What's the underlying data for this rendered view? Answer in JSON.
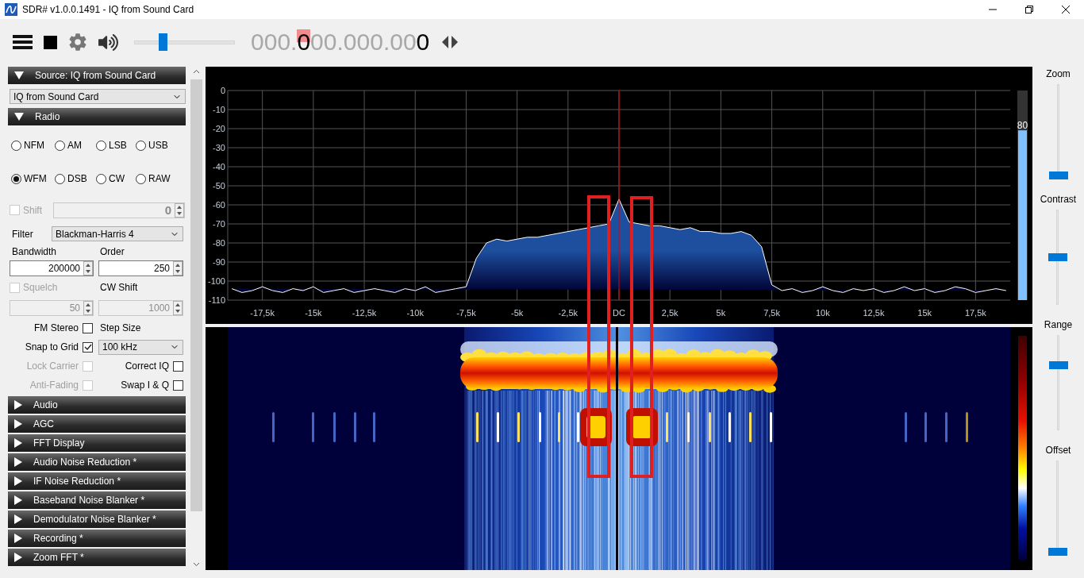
{
  "window": {
    "title": "SDR# v1.0.0.1491 - IQ from Sound Card"
  },
  "toolbar": {
    "volume": {
      "level": 0.27
    },
    "frequency": [
      {
        "kind": "digit",
        "text": "0",
        "lit": false,
        "hover": false
      },
      {
        "kind": "digit",
        "text": "0",
        "lit": false,
        "hover": false
      },
      {
        "kind": "digit",
        "text": "0",
        "lit": false,
        "hover": false
      },
      {
        "kind": "separator",
        "text": "."
      },
      {
        "kind": "digit",
        "text": "0",
        "lit": true,
        "hover": true
      },
      {
        "kind": "digit",
        "text": "0",
        "lit": false,
        "hover": false
      },
      {
        "kind": "digit",
        "text": "0",
        "lit": false,
        "hover": false
      },
      {
        "kind": "separator",
        "text": "."
      },
      {
        "kind": "digit",
        "text": "0",
        "lit": false,
        "hover": false
      },
      {
        "kind": "digit",
        "text": "0",
        "lit": false,
        "hover": false
      },
      {
        "kind": "digit",
        "text": "0",
        "lit": false,
        "hover": false
      },
      {
        "kind": "separator",
        "text": "."
      },
      {
        "kind": "digit",
        "text": "0",
        "lit": false,
        "hover": false
      },
      {
        "kind": "digit",
        "text": "0",
        "lit": false,
        "hover": false
      },
      {
        "kind": "digit",
        "text": "0",
        "lit": true,
        "hover": false
      }
    ]
  },
  "sidebar": {
    "source": {
      "title": "Source: IQ from Sound Card",
      "expanded": true,
      "device": "IQ from Sound Card"
    },
    "radio": {
      "title": "Radio",
      "expanded": true,
      "modes": [
        {
          "label": "NFM",
          "selected": false
        },
        {
          "label": "AM",
          "selected": false
        },
        {
          "label": "LSB",
          "selected": false
        },
        {
          "label": "USB",
          "selected": false
        },
        {
          "label": "WFM",
          "selected": true
        },
        {
          "label": "DSB",
          "selected": false
        },
        {
          "label": "CW",
          "selected": false
        },
        {
          "label": "RAW",
          "selected": false
        }
      ],
      "shift": {
        "label": "Shift",
        "checked": false,
        "disabled": true,
        "value": "0"
      },
      "filter": {
        "label": "Filter",
        "value": "Blackman-Harris 4"
      },
      "bandwidth": {
        "label": "Bandwidth",
        "value": "200000"
      },
      "order": {
        "label": "Order",
        "value": "250"
      },
      "squelch": {
        "label": "Squelch",
        "checked": false,
        "disabled": true,
        "value": "50"
      },
      "cw_shift": {
        "label": "CW Shift",
        "disabled": true,
        "value": "1000"
      },
      "left_checks": [
        {
          "label": "FM Stereo",
          "checked": false,
          "disabled": false
        },
        {
          "label": "Snap to Grid",
          "checked": true,
          "disabled": false
        },
        {
          "label": "Lock Carrier",
          "checked": false,
          "disabled": true
        },
        {
          "label": "Anti-Fading",
          "checked": false,
          "disabled": true
        }
      ],
      "step_size": {
        "label": "Step Size",
        "value": "100 kHz"
      },
      "right_checks": [
        {
          "label": "Correct IQ",
          "checked": false
        },
        {
          "label": "Swap I & Q",
          "checked": false
        }
      ]
    },
    "sections": [
      {
        "title": "Audio",
        "expanded": false
      },
      {
        "title": "AGC",
        "expanded": false
      },
      {
        "title": "FFT Display",
        "expanded": false
      },
      {
        "title": "Audio Noise Reduction *",
        "expanded": false
      },
      {
        "title": "IF Noise Reduction *",
        "expanded": false
      },
      {
        "title": "Baseband Noise Blanker *",
        "expanded": false
      },
      {
        "title": "Demodulator Noise Blanker *",
        "expanded": false
      },
      {
        "title": "Recording *",
        "expanded": false
      },
      {
        "title": "Zoom FFT *",
        "expanded": false
      }
    ]
  },
  "spectrum": {
    "chart_data": {
      "type": "area",
      "grid": true,
      "ref_lines": [
        {
          "axis": "x",
          "value": 0,
          "color": "#e00000"
        }
      ],
      "xlim": [
        -19.2,
        19.2
      ],
      "ylim": [
        -110,
        0
      ],
      "x": [
        -19,
        -18.5,
        -18,
        -17.5,
        -17,
        -16.5,
        -16,
        -15.5,
        -15,
        -14.5,
        -14,
        -13.5,
        -13,
        -12.5,
        -12,
        -11.5,
        -11,
        -10.5,
        -10,
        -9.5,
        -9,
        -8.5,
        -8,
        -7.5,
        -7,
        -6.5,
        -6,
        -5.5,
        -5,
        -4.5,
        -4,
        -3.5,
        -3,
        -2.5,
        -2,
        -1.5,
        -1,
        -0.5,
        0,
        0.5,
        1,
        1.5,
        2,
        2.5,
        3,
        3.5,
        4,
        4.5,
        5,
        5.5,
        6,
        6.5,
        7,
        7.5,
        8,
        8.5,
        9,
        9.5,
        10,
        10.5,
        11,
        11.5,
        12,
        12.5,
        13,
        13.5,
        14,
        14.5,
        15,
        15.5,
        16,
        16.5,
        17,
        17.5,
        18,
        18.5,
        19
      ],
      "series": [
        {
          "color": "#ffffff",
          "values": [
            -104,
            -106,
            -105,
            -103,
            -105,
            -106,
            -104,
            -105,
            -103,
            -106,
            -105,
            -104,
            -106,
            -105,
            -104,
            -105,
            -106,
            -104,
            -105,
            -103,
            -106,
            -105,
            -104,
            -103,
            -88,
            -80,
            -78,
            -79,
            -78,
            -77,
            -77,
            -76,
            -75,
            -74,
            -73,
            -72,
            -71,
            -70,
            -57,
            -69,
            -70,
            -71,
            -71,
            -72,
            -73,
            -72,
            -74,
            -74,
            -75,
            -75,
            -74,
            -76,
            -82,
            -102,
            -105,
            -104,
            -106,
            -105,
            -103,
            -105,
            -106,
            -104,
            -105,
            -104,
            -106,
            -105,
            -103,
            -105,
            -104,
            -106,
            -105,
            -103,
            -104,
            -106,
            -105,
            -104,
            -105
          ]
        }
      ],
      "yticks": [
        0,
        -10,
        -20,
        -30,
        -40,
        -50,
        -60,
        -70,
        -80,
        -90,
        -100,
        -110
      ],
      "xticks": [
        {
          "value": -17.5,
          "label": "-17,5k"
        },
        {
          "value": -15,
          "label": "-15k"
        },
        {
          "value": -12.5,
          "label": "-12,5k"
        },
        {
          "value": -10,
          "label": "-10k"
        },
        {
          "value": -7.5,
          "label": "-7,5k"
        },
        {
          "value": -5,
          "label": "-5k"
        },
        {
          "value": -2.5,
          "label": "-2,5k"
        },
        {
          "value": 0,
          "label": "DC"
        },
        {
          "value": 2.5,
          "label": "2,5k"
        },
        {
          "value": 5,
          "label": "5k"
        },
        {
          "value": 7.5,
          "label": "7,5k"
        },
        {
          "value": 10,
          "label": "10k"
        },
        {
          "value": 12.5,
          "label": "12,5k"
        },
        {
          "value": 15,
          "label": "15k"
        },
        {
          "value": 17.5,
          "label": "17,5k"
        }
      ]
    },
    "meter": {
      "reading": "80",
      "level": 0.81
    }
  },
  "display_sliders": [
    {
      "label": "Zoom",
      "level": 0.0
    },
    {
      "label": "Contrast",
      "level": 0.5
    },
    {
      "label": "Range",
      "level": 0.7
    },
    {
      "label": "Offset",
      "level": 0.0
    }
  ]
}
